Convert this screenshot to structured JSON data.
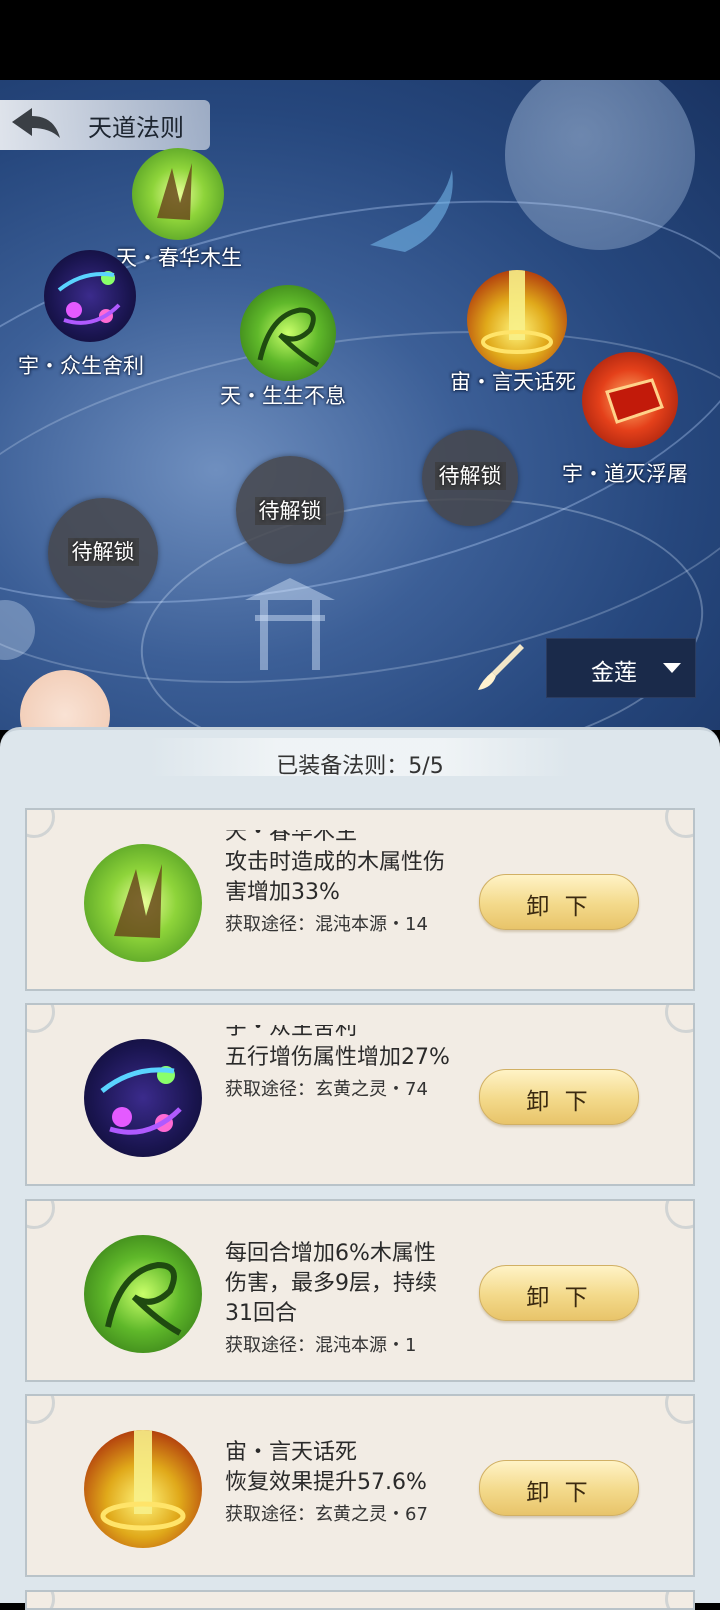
{
  "header": {
    "title": "天道法则"
  },
  "skill_map": {
    "nodes": [
      {
        "label": "天・春华木生",
        "icon": "green-thorn-icon"
      },
      {
        "label": "宇・众生舍利",
        "icon": "purple-orb-icon"
      },
      {
        "label": "天・生生不息",
        "icon": "green-vine-icon"
      },
      {
        "label": "宙・言天话死",
        "icon": "golden-beam-icon"
      },
      {
        "label": "宇・道灭浮屠",
        "icon": "red-crystal-icon"
      }
    ],
    "locked_label": "待解锁"
  },
  "style_select": {
    "value": "金莲"
  },
  "equipped": {
    "title": "已装备法则：5/5",
    "unload_label": "卸 下",
    "cards": [
      {
        "name": "天・春华木生",
        "desc": "攻击时造成的木属性伤害增加33%",
        "source": "获取途径：混沌本源・14",
        "icon": "green-thorn-icon"
      },
      {
        "name": "宇・众生舍利",
        "desc": "五行增伤属性增加27%",
        "source": "获取途径：玄黄之灵・74",
        "icon": "purple-orb-icon"
      },
      {
        "name": "",
        "desc": "每回合增加6%木属性伤害，最多9层，持续31回合",
        "source": "获取途径：混沌本源・1",
        "icon": "green-vine-icon"
      },
      {
        "name": "宙・言天话死",
        "desc": "恢复效果提升57.6%",
        "source": "获取途径：玄黄之灵・67",
        "icon": "golden-beam-icon"
      }
    ]
  }
}
